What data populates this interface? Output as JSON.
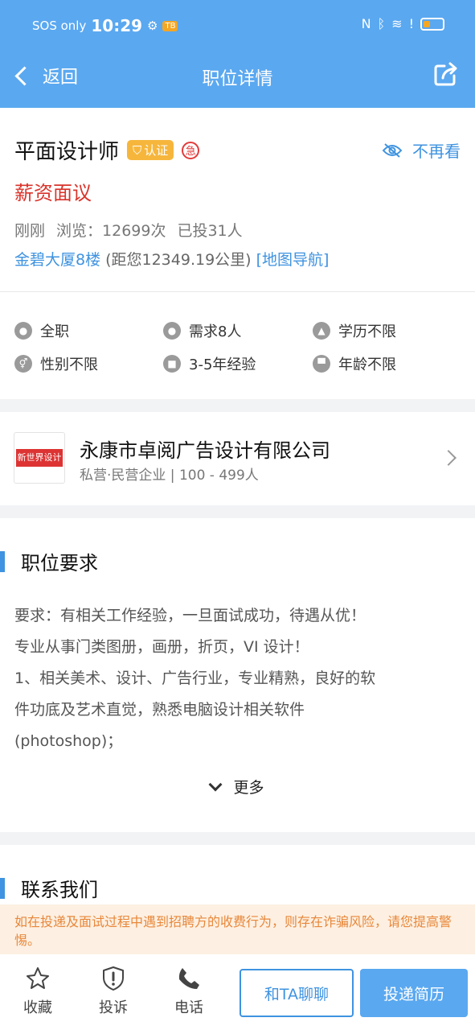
{
  "status": {
    "carrier": "SOS only",
    "time": "10:29",
    "badge": "TB"
  },
  "header": {
    "back_label": "返回",
    "title": "职位详情"
  },
  "job": {
    "title": "平面设计师",
    "cert_label": "认证",
    "urgent_label": "急",
    "hide_label": "不再看",
    "salary": "薪资面议",
    "posted": "刚刚",
    "views": "浏览：12699次",
    "applied": "已投31人",
    "address": "金碧大厦8楼",
    "distance": "(距您12349.19公里)",
    "map_nav": "[地图导航]",
    "attributes": [
      {
        "icon": "person-icon",
        "label": "全职"
      },
      {
        "icon": "group-icon",
        "label": "需求8人"
      },
      {
        "icon": "graduation-cap-icon",
        "label": "学历不限"
      },
      {
        "icon": "gender-icon",
        "label": "性别不限"
      },
      {
        "icon": "briefcase-icon",
        "label": "3-5年经验"
      },
      {
        "icon": "cake-icon",
        "label": "年龄不限"
      }
    ]
  },
  "company": {
    "logo_text": "新世界设计",
    "name": "永康市卓阅广告设计有限公司",
    "info": "私营·民营企业 | 100 - 499人"
  },
  "requirements": {
    "heading": "职位要求",
    "lines": [
      "要求：有相关工作经验，一旦面试成功，待遇从优！",
      "专业从事门类图册，画册，折页，VI 设计！",
      "1、相关美术、设计、广告行业，专业精熟，良好的软",
      "件功底及艺术直觉，熟悉电脑设计相关软件",
      "(photoshop)；"
    ],
    "more_label": "更多"
  },
  "contact": {
    "heading": "联系我们",
    "warning": "如在投递及面试过程中遇到招聘方的收费行为，则存在诈骗风险，请您提高警惕。"
  },
  "bottom": {
    "favorite_label": "收藏",
    "report_label": "投诉",
    "phone_label": "电话",
    "chat_label": "和TA聊聊",
    "apply_label": "投递简历"
  },
  "colors": {
    "primary": "#5aa8f0",
    "link": "#3f93e0",
    "salary": "#d9342b",
    "warning_bg": "#fdf0e2",
    "warning_text": "#e8873a"
  }
}
